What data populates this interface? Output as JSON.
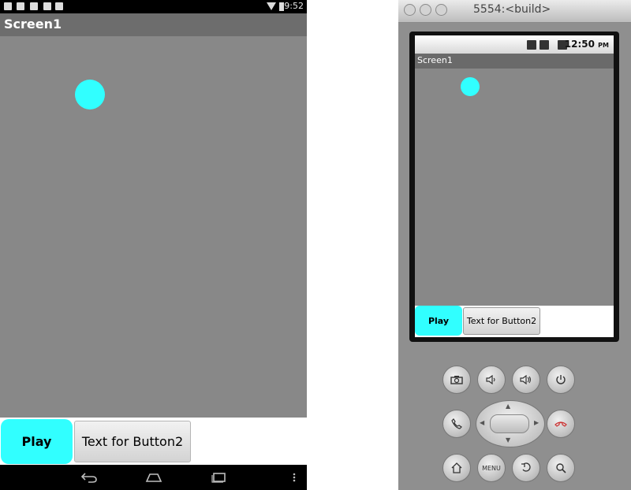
{
  "device": {
    "status_bar": {
      "time": "9:52"
    },
    "title_bar": {
      "title": "Screen1"
    },
    "canvas": {
      "background": "#888888",
      "ball_color": "#31ffff"
    },
    "buttons": {
      "play_label": "Play",
      "button2_label": "Text for Button2",
      "play_color": "#31ffff"
    },
    "nav_bar": {
      "back_icon": "back-icon",
      "home_icon": "home-icon",
      "recents_icon": "recents-icon",
      "menu_icon": "overflow-menu-icon"
    }
  },
  "emulator": {
    "window_title": "5554:<build>",
    "status_bar": {
      "time": "12:50",
      "ampm": "PM"
    },
    "title_bar": {
      "title": "Screen1"
    },
    "buttons": {
      "play_label": "Play",
      "button2_label": "Text for Button2"
    },
    "hardware_buttons": {
      "menu_label": "MENU"
    }
  }
}
